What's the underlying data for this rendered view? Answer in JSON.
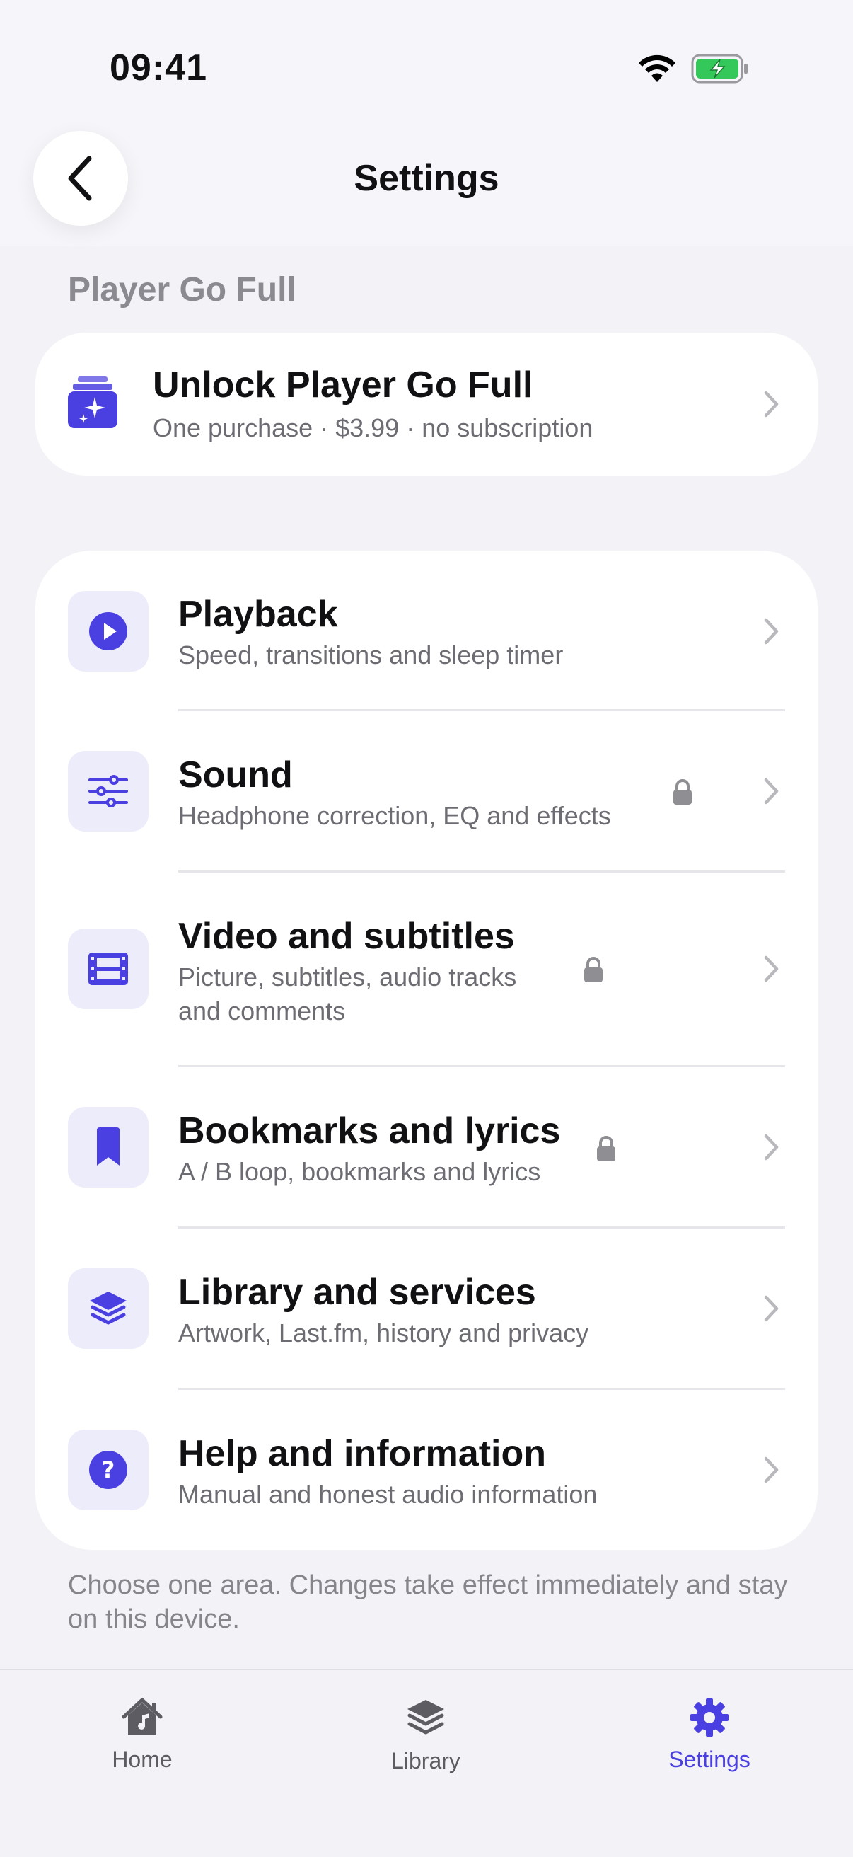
{
  "status_bar": {
    "time": "09:41"
  },
  "nav": {
    "title": "Settings"
  },
  "section_header": "Player Go Full",
  "unlock": {
    "title": "Unlock Player Go Full",
    "subtitle": "One purchase · $3.99 · no subscription"
  },
  "rows": [
    {
      "title": "Playback",
      "subtitle": "Speed, transitions and sleep timer",
      "locked": false,
      "icon": "play-icon"
    },
    {
      "title": "Sound",
      "subtitle": "Headphone correction, EQ and effects",
      "locked": true,
      "icon": "sliders-icon"
    },
    {
      "title": "Video and subtitles",
      "subtitle_line1": "Picture, subtitles, audio tracks",
      "subtitle_line2": "and comments",
      "locked": true,
      "icon": "film-icon"
    },
    {
      "title": "Bookmarks and lyrics",
      "subtitle": "A / B loop, bookmarks and lyrics",
      "locked": true,
      "icon": "bookmark-icon"
    },
    {
      "title": "Library and services",
      "subtitle": "Artwork, Last.fm, history and privacy",
      "locked": false,
      "icon": "layers-icon"
    },
    {
      "title": "Help and information",
      "subtitle": "Manual and honest audio information",
      "locked": false,
      "icon": "help-icon"
    }
  ],
  "footnote": "Choose one area. Changes take effect immediately and stay on this device.",
  "tabs": [
    {
      "label": "Home",
      "active": false
    },
    {
      "label": "Library",
      "active": false
    },
    {
      "label": "Settings",
      "active": true
    }
  ],
  "colors": {
    "accent": "#4a3fe0",
    "background": "#f2f2f7",
    "icon_bg": "#ececfb",
    "battery_green": "#34c759"
  }
}
